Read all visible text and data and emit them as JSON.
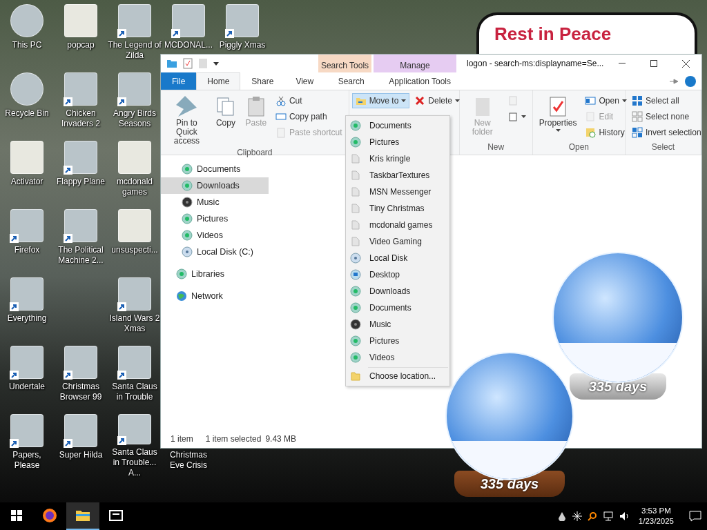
{
  "desktop": {
    "columns": [
      [
        {
          "label": "This PC",
          "kind": "system"
        },
        {
          "label": "Recycle Bin",
          "kind": "system"
        },
        {
          "label": "Activator",
          "kind": "folder"
        },
        {
          "label": "Firefox",
          "kind": "shortcut"
        },
        {
          "label": "Everything",
          "kind": "shortcut"
        },
        {
          "label": "Undertale",
          "kind": "shortcut"
        },
        {
          "label": "Papers, Please",
          "kind": "shortcut"
        }
      ],
      [
        {
          "label": "popcap",
          "kind": "folder"
        },
        {
          "label": "Chicken Invaders 2",
          "kind": "shortcut"
        },
        {
          "label": "Flappy Plane",
          "kind": "shortcut"
        },
        {
          "label": "The Political Machine 2...",
          "kind": "shortcut"
        },
        {
          "kind": "empty"
        },
        {
          "label": "Christmas Browser 99",
          "kind": "shortcut"
        },
        {
          "label": "Super Hilda",
          "kind": "shortcut"
        }
      ],
      [
        {
          "label": "The Legend of Zilda",
          "kind": "shortcut"
        },
        {
          "label": "Angry Birds Seasons",
          "kind": "shortcut"
        },
        {
          "label": "mcdonald games",
          "kind": "folder"
        },
        {
          "label": "unsuspecti...",
          "kind": "folder"
        },
        {
          "label": "Island Wars 2 Xmas",
          "kind": "shortcut"
        },
        {
          "label": "Santa Claus in Trouble",
          "kind": "shortcut"
        },
        {
          "label": "Santa Claus in Trouble... A...",
          "kind": "shortcut"
        }
      ],
      [
        {
          "label": "MCDONAL...",
          "kind": "shortcut"
        },
        {
          "kind": "empty"
        },
        {
          "kind": "empty"
        },
        {
          "kind": "empty"
        },
        {
          "kind": "empty"
        },
        {
          "kind": "empty"
        },
        {
          "label": "Christmas Eve Crisis",
          "kind": "covered"
        }
      ],
      [
        {
          "label": "Piggly Xmas",
          "kind": "shortcut"
        }
      ]
    ]
  },
  "sign": {
    "text": "Rest in Peace"
  },
  "gadgets": [
    {
      "days": "335 days"
    },
    {
      "days": "335 days"
    }
  ],
  "window": {
    "title": "logon - search-ms:displayname=Se...",
    "context_tabs": [
      {
        "label": "Search Tools",
        "color": "#f7d9c4"
      },
      {
        "label": "Manage",
        "color": "#e6ccf2"
      }
    ],
    "tabs": [
      {
        "label": "File",
        "kind": "file",
        "selected": false
      },
      {
        "label": "Home",
        "kind": "tab",
        "selected": true
      },
      {
        "label": "Share",
        "kind": "tab",
        "selected": false
      },
      {
        "label": "View",
        "kind": "tab",
        "selected": false
      },
      {
        "label": "Search",
        "kind": "tab",
        "selected": false
      },
      {
        "label": "Application Tools",
        "kind": "tab",
        "selected": false
      }
    ],
    "ribbon": [
      {
        "label": "Clipboard",
        "columns": [
          [
            {
              "label": "Pin to Quick access",
              "kind": "large",
              "disabled": false
            }
          ],
          [
            {
              "label": "Copy",
              "kind": "large",
              "disabled": false
            }
          ],
          [
            {
              "label": "Paste",
              "kind": "large",
              "disabled": true
            }
          ],
          [
            {
              "label": "Cut",
              "kind": "small",
              "disabled": false
            },
            {
              "label": "Copy path",
              "kind": "small",
              "disabled": false
            },
            {
              "label": "Paste shortcut",
              "kind": "small",
              "disabled": true
            }
          ]
        ]
      },
      {
        "columns": [
          [
            {
              "label": "Move to",
              "kind": "small",
              "disabled": false,
              "pressed": true,
              "dropdown": true
            }
          ],
          [
            {
              "label": "Delete",
              "kind": "small",
              "disabled": false,
              "dropdown": true
            }
          ]
        ]
      },
      {
        "label": "New",
        "columns": [
          [
            {
              "label": "New folder",
              "kind": "large",
              "disabled": true
            }
          ],
          [
            {
              "kind": "small",
              "disabled": true
            },
            {
              "kind": "small",
              "disabled": false,
              "dropdown": true
            }
          ]
        ]
      },
      {
        "label": "Open",
        "columns": [
          [
            {
              "label": "Properties",
              "kind": "large",
              "disabled": false,
              "dropdown": true
            }
          ],
          [
            {
              "label": "Open",
              "kind": "small",
              "disabled": false,
              "dropdown": true
            },
            {
              "label": "Edit",
              "kind": "small",
              "disabled": true
            },
            {
              "label": "History",
              "kind": "small",
              "disabled": false
            }
          ]
        ]
      },
      {
        "label": "Select",
        "columns": [
          [
            {
              "label": "Select all",
              "kind": "small",
              "disabled": false
            },
            {
              "label": "Select none",
              "kind": "small",
              "disabled": false
            },
            {
              "label": "Invert selection",
              "kind": "small",
              "disabled": false
            }
          ]
        ]
      }
    ],
    "nav_pane": {
      "items": [
        {
          "label": "Documents",
          "kind": "library",
          "selected": false
        },
        {
          "label": "Downloads",
          "kind": "library",
          "selected": true
        },
        {
          "label": "Music",
          "kind": "music",
          "selected": false
        },
        {
          "label": "Pictures",
          "kind": "library",
          "selected": false
        },
        {
          "label": "Videos",
          "kind": "library",
          "selected": false
        },
        {
          "label": "Local Disk (C:)",
          "kind": "disk",
          "selected": false
        }
      ],
      "roots": [
        {
          "label": "Libraries",
          "kind": "library",
          "selected": false
        },
        {
          "label": "Network",
          "kind": "network",
          "selected": false
        }
      ]
    },
    "menu": {
      "items": [
        {
          "label": "Documents",
          "kind": "library"
        },
        {
          "label": "Pictures",
          "kind": "library"
        },
        {
          "label": "Kris kringle",
          "kind": "folder"
        },
        {
          "label": "TaskbarTextures",
          "kind": "folder"
        },
        {
          "label": "MSN Messenger",
          "kind": "folder"
        },
        {
          "label": "Tiny Christmas",
          "kind": "folder"
        },
        {
          "label": "mcdonald games",
          "kind": "folder"
        },
        {
          "label": "Video Gaming",
          "kind": "folder"
        },
        {
          "label": "Local Disk",
          "kind": "disk"
        },
        {
          "label": "Desktop",
          "kind": "desktop"
        },
        {
          "label": "Downloads",
          "kind": "library"
        },
        {
          "label": "Documents",
          "kind": "library"
        },
        {
          "label": "Music",
          "kind": "music"
        },
        {
          "label": "Pictures",
          "kind": "library"
        },
        {
          "label": "Videos",
          "kind": "library"
        }
      ],
      "footer": {
        "label": "Choose location...",
        "kind": "choose"
      }
    },
    "status_bar": {
      "count": "1 item",
      "selection": "1 item selected",
      "size": "9.43 MB"
    }
  },
  "taskbar": {
    "apps": [
      {
        "kind": "firefox",
        "active": false
      },
      {
        "kind": "explorer",
        "active": true
      },
      {
        "kind": "sevenzip",
        "active": false
      }
    ],
    "tray": {
      "time": "3:53 PM",
      "date": "1/23/2025"
    }
  }
}
